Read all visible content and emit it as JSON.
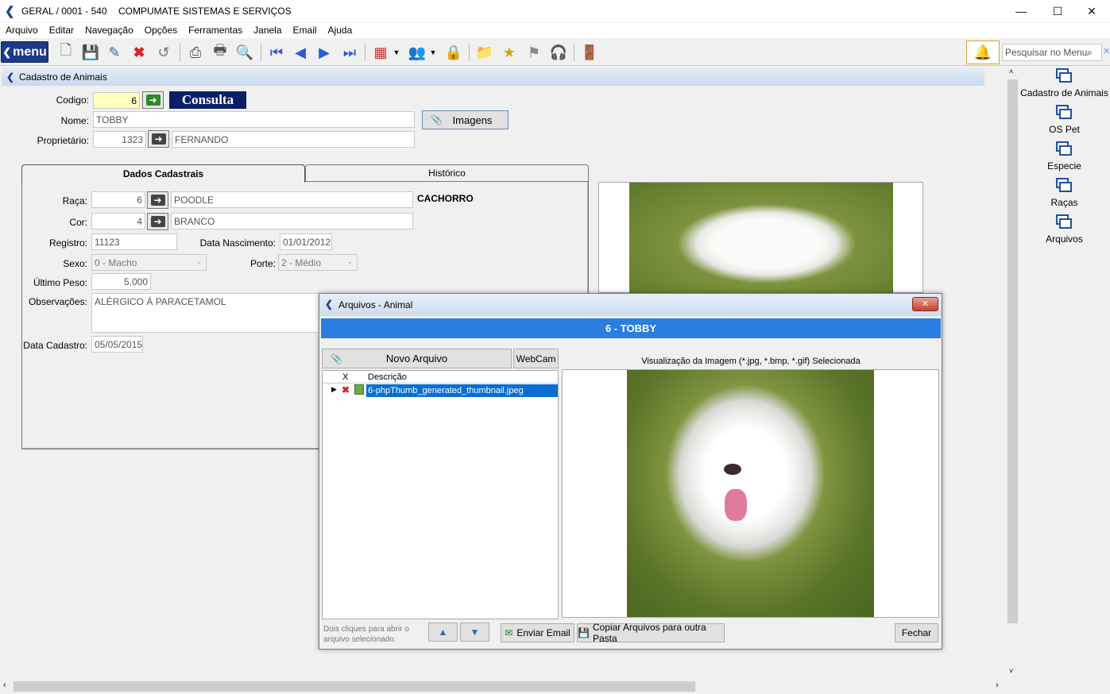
{
  "titlebar": {
    "app": "GERAL / 0001 - 540",
    "company": "COMPUMATE SISTEMAS E SERVIÇOS",
    "minimize": "—",
    "maximize": "☐",
    "close": "✕"
  },
  "menu": [
    "Arquivo",
    "Editar",
    "Navegação",
    "Opções",
    "Ferramentas",
    "Janela",
    "Email",
    "Ajuda"
  ],
  "toolbar": {
    "menu_label": "menu",
    "search_placeholder": "Pesquisar no Menu"
  },
  "form": {
    "title": "Cadastro de Animais",
    "codigo_label": "Codigo:",
    "codigo_value": "6",
    "mode": "Consulta",
    "nome_label": "Nome:",
    "nome_value": "TOBBY",
    "imagens_label": "Imagens",
    "proprietario_label": "Proprietário:",
    "proprietario_code": "1323",
    "proprietario_name": "FERNANDO",
    "tabs": [
      "Dados Cadastrais",
      "Histórico"
    ],
    "raca_label": "Raça:",
    "raca_code": "6",
    "raca_name": "POODLE",
    "especie": "CACHORRO",
    "cor_label": "Cor:",
    "cor_code": "4",
    "cor_name": "BRANCO",
    "registro_label": "Registro:",
    "registro_value": "11123",
    "nascimento_label": "Data Nascimento:",
    "nascimento_value": "01/01/2012",
    "sexo_label": "Sexo:",
    "sexo_value": "0 - Macho",
    "porte_label": "Porte:",
    "porte_value": "2 - Médio",
    "peso_label": "Último Peso:",
    "peso_value": "5,000",
    "obs_label": "Observações:",
    "obs_value": "ALÉRGICO Á PARACETAMOL",
    "cadastro_label": "Data Cadastro:",
    "cadastro_value": "05/05/2015"
  },
  "sidebar": [
    "Cadastro de Animais",
    "OS Pet",
    "Especie",
    "Raças",
    "Arquivos"
  ],
  "dialog": {
    "title": "Arquivos - Animal",
    "header": "6 - TOBBY",
    "novo_label": "Novo Arquivo",
    "webcam_label": "WebCam",
    "preview_caption": "Visualização da Imagem (*.jpg, *.bmp, *.gif) Selecionada",
    "col_x": "X",
    "col_desc": "Descrição",
    "files": [
      "6-phpThumb_generated_thumbnail.jpeg"
    ],
    "hint": "Dois cliques para abrir o arquivo selecionado.",
    "email_label": "Enviar Email",
    "copy_label": "Copiar Arquivos para outra Pasta",
    "close_label": "Fechar"
  }
}
